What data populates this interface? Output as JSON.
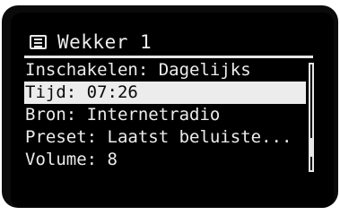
{
  "header": {
    "icon": "menu-list-icon",
    "title": "Wekker 1"
  },
  "menu": {
    "items": [
      {
        "label": "Inschakelen: Dagelijks",
        "selected": false
      },
      {
        "label": "Tijd: 07:26",
        "selected": true
      },
      {
        "label": "Bron: Internetradio",
        "selected": false
      },
      {
        "label": "Preset: Laatst beluiste...",
        "selected": false
      },
      {
        "label": "Volume: 8",
        "selected": false
      }
    ]
  },
  "scrollbar": {
    "position": 0.85,
    "thumb_fraction": 0.18
  },
  "colors": {
    "screen_background": "#000000",
    "foreground": "#ececec",
    "selection_background": "#ececec",
    "selection_text": "#0a0a0a"
  }
}
